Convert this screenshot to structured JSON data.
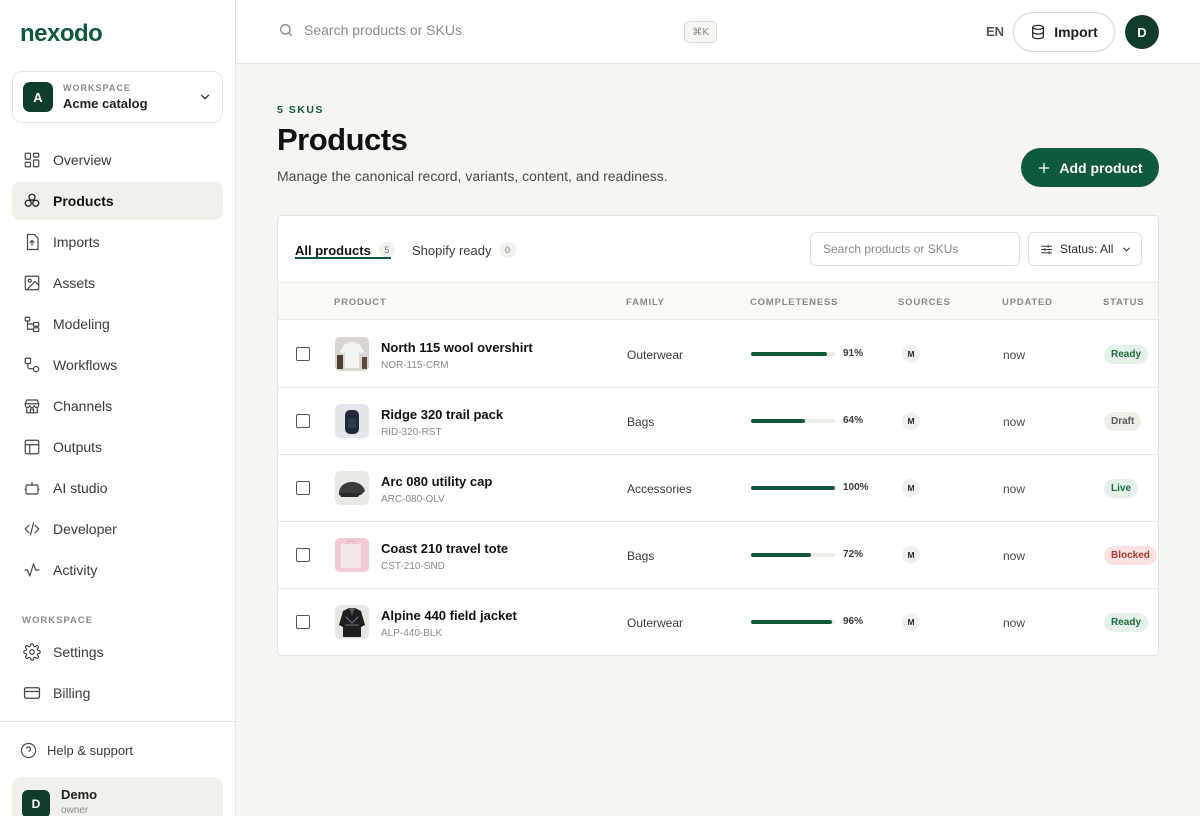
{
  "app": {
    "logo": "nexodo"
  },
  "workspace": {
    "label": "WORKSPACE",
    "name": "Acme catalog",
    "initial": "A"
  },
  "nav": [
    {
      "label": "Overview",
      "icon": "grid-icon",
      "active": false
    },
    {
      "label": "Products",
      "icon": "products-icon",
      "active": true
    },
    {
      "label": "Imports",
      "icon": "import-file-icon",
      "active": false
    },
    {
      "label": "Assets",
      "icon": "image-icon",
      "active": false
    },
    {
      "label": "Modeling",
      "icon": "tree-icon",
      "active": false
    },
    {
      "label": "Workflows",
      "icon": "workflow-icon",
      "active": false
    },
    {
      "label": "Channels",
      "icon": "store-icon",
      "active": false
    },
    {
      "label": "Outputs",
      "icon": "layout-icon",
      "active": false
    },
    {
      "label": "AI studio",
      "icon": "bot-icon",
      "active": false
    },
    {
      "label": "Developer",
      "icon": "code-icon",
      "active": false
    },
    {
      "label": "Activity",
      "icon": "activity-icon",
      "active": false
    }
  ],
  "nav_section": "WORKSPACE",
  "nav2": [
    {
      "label": "Settings",
      "icon": "gear-icon"
    },
    {
      "label": "Billing",
      "icon": "card-icon"
    }
  ],
  "help": {
    "label": "Help & support"
  },
  "user": {
    "name": "Demo",
    "role": "owner",
    "initial": "D"
  },
  "topbar": {
    "search_placeholder": "Search products or SKUs",
    "shortcut": "⌘K",
    "lang": "EN",
    "import_label": "Import",
    "avatar_initial": "D"
  },
  "header": {
    "eyebrow": "5 SKUS",
    "title": "Products",
    "subtitle": "Manage the canonical record, variants, content, and readiness.",
    "add_label": "Add product"
  },
  "tabs": [
    {
      "label": "All products",
      "count": "5",
      "active": true
    },
    {
      "label": "Shopify ready",
      "count": "0",
      "active": false
    }
  ],
  "card": {
    "search_placeholder": "Search products or SKUs",
    "status_filter": "Status: All"
  },
  "columns": [
    "PRODUCT",
    "FAMILY",
    "COMPLETENESS",
    "SOURCES",
    "UPDATED",
    "STATUS"
  ],
  "rows": [
    {
      "name": "North 115 wool overshirt",
      "sku": "NOR-115-CRM",
      "family": "Outerwear",
      "completeness": 91,
      "pct": "91%",
      "source": "M",
      "updated": "now",
      "status": "Ready",
      "status_color": "#e4f1e7",
      "status_text": "#1d6b3e",
      "thumb": "shirt"
    },
    {
      "name": "Ridge 320 trail pack",
      "sku": "RID-320-RST",
      "family": "Bags",
      "completeness": 64,
      "pct": "64%",
      "source": "M",
      "updated": "now",
      "status": "Draft",
      "status_color": "#efeee9",
      "status_text": "#5a5a55",
      "thumb": "pack"
    },
    {
      "name": "Arc 080 utility cap",
      "sku": "ARC-080-OLV",
      "family": "Accessories",
      "completeness": 100,
      "pct": "100%",
      "source": "M",
      "updated": "now",
      "status": "Live",
      "status_color": "#e4f1e7",
      "status_text": "#1d6b3e",
      "thumb": "cap"
    },
    {
      "name": "Coast 210 travel tote",
      "sku": "CST-210-SND",
      "family": "Bags",
      "completeness": 72,
      "pct": "72%",
      "source": "M",
      "updated": "now",
      "status": "Blocked",
      "status_color": "#f8e3e2",
      "status_text": "#b03a33",
      "thumb": "tote"
    },
    {
      "name": "Alpine 440 field jacket",
      "sku": "ALP-440-BLK",
      "family": "Outerwear",
      "completeness": 96,
      "pct": "96%",
      "source": "M",
      "updated": "now",
      "status": "Ready",
      "status_color": "#e4f1e7",
      "status_text": "#1d6b3e",
      "thumb": "jacket"
    }
  ],
  "colors": {
    "brand": "#0f5a3a",
    "brand_dark": "#0f3d2a",
    "background": "#f6f5f1"
  }
}
